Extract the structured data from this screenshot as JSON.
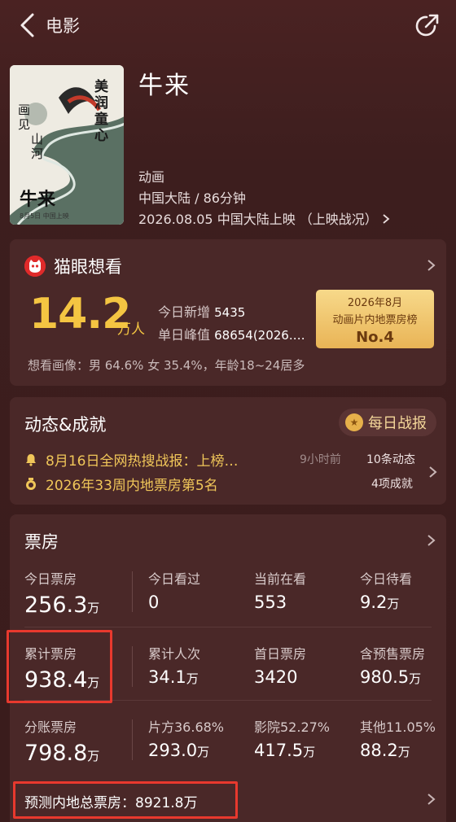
{
  "nav": {
    "title": "电影"
  },
  "movie": {
    "title": "牛来",
    "genre": "动画",
    "region_duration": "中国大陆 / 86分钟",
    "release": "2026.08.05 中国大陆上映 （上映战况）",
    "poster": {
      "calligraphy": [
        "美",
        "润",
        "童",
        "心"
      ],
      "subtitle": [
        "画",
        "见",
        "山",
        "河"
      ],
      "name": "牛来",
      "footer": "8月5日 中国上映"
    }
  },
  "want": {
    "title": "猫眼想看",
    "total": "14.2",
    "unit": "万人",
    "today_label": "今日新增",
    "today_value": "5435",
    "peak_label": "单日峰值",
    "peak_value": "68654(2026.…",
    "badge_line1": "2026年8月",
    "badge_line2": "动画片内地票房榜",
    "badge_rank": "No.4",
    "portrait": "想看画像：男 64.6%  女 35.4%，年龄18~24居多"
  },
  "dynamics": {
    "title": "动态&成就",
    "daily_label": "每日战报",
    "news": "8月16日全网热搜战报：上榜…",
    "news_time": "9小时前",
    "news_count": "10条动态",
    "achievement": "2026年33周内地票房第5名",
    "achievement_count": "4项成就"
  },
  "boxoffice": {
    "title": "票房",
    "rows": [
      [
        {
          "label": "今日票房",
          "value": "256.3",
          "unit": "万"
        },
        {
          "label": "今日看过",
          "value": "0",
          "unit": ""
        },
        {
          "label": "当前在看",
          "value": "553",
          "unit": ""
        },
        {
          "label": "今日待看",
          "value": "9.2",
          "unit": "万"
        }
      ],
      [
        {
          "label": "累计票房",
          "value": "938.4",
          "unit": "万"
        },
        {
          "label": "累计人次",
          "value": "34.1",
          "unit": "万"
        },
        {
          "label": "首日票房",
          "value": "3420",
          "unit": ""
        },
        {
          "label": "含预售票房",
          "value": "980.5",
          "unit": "万"
        }
      ],
      [
        {
          "label": "分账票房",
          "value": "798.8",
          "unit": "万"
        },
        {
          "label": "片方36.68%",
          "value": "293.0",
          "unit": "万"
        },
        {
          "label": "影院52.27%",
          "value": "417.5",
          "unit": "万"
        },
        {
          "label": "其他11.05%",
          "value": "88.2",
          "unit": "万"
        }
      ]
    ],
    "forecast_label": "预测内地总票房：",
    "forecast_value": "8921.8万"
  },
  "colors": {
    "accent_gold": "#f4c542",
    "highlight_red": "#e8392e",
    "background": "#3a1e1e"
  }
}
